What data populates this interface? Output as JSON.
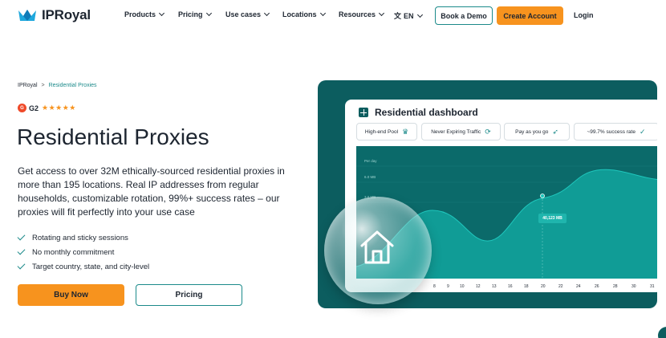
{
  "nav": {
    "brand": "IPRoyal",
    "items": [
      {
        "label": "Products",
        "has_dropdown": true
      },
      {
        "label": "Pricing",
        "has_dropdown": true
      },
      {
        "label": "Use cases",
        "has_dropdown": true
      },
      {
        "label": "Locations",
        "has_dropdown": true
      },
      {
        "label": "Resources",
        "has_dropdown": true
      }
    ],
    "language": "EN",
    "book_demo": "Book a Demo",
    "create_account": "Create Account",
    "login": "Login"
  },
  "breadcrumb": {
    "home": "IPRoyal",
    "current": "Residential Proxies"
  },
  "rating": {
    "badge": "G",
    "label": "G2",
    "stars": "★★★★★",
    "score": 4.5
  },
  "hero": {
    "title": "Residential Proxies",
    "description": "Get access to over 32M ethically-sourced residential proxies in more than 195 locations. Real IP addresses from regular households, customizable rotation, 99%+ success rates – our proxies will fit perfectly into your use case",
    "features": [
      "Rotating and sticky sessions",
      "No monthly commitment",
      "Target country, state, and city-level"
    ],
    "buy_label": "Buy Now",
    "pricing_label": "Pricing"
  },
  "dashboard": {
    "title": "Residential dashboard",
    "pills": [
      {
        "label": "High-end Pool",
        "icon": "crown-icon"
      },
      {
        "label": "Never Expiring Traffic",
        "icon": "refresh-icon"
      },
      {
        "label": "Pay as you go",
        "icon": "rocket-icon"
      },
      {
        "label": "~99.7%  success rate",
        "icon": "check-circle-icon"
      }
    ],
    "y_labels": [
      "Per day",
      "6.0 MB",
      "3.0 MB"
    ],
    "x_labels": [
      "8",
      "9",
      "10",
      "12",
      "13",
      "16",
      "18",
      "20",
      "22",
      "24",
      "26",
      "28",
      "30",
      "31"
    ],
    "tooltip": "40,123 MB"
  },
  "colors": {
    "accent_orange": "#f7931e",
    "brand_teal": "#0c5d5f",
    "border_teal": "#1b8a8a"
  }
}
